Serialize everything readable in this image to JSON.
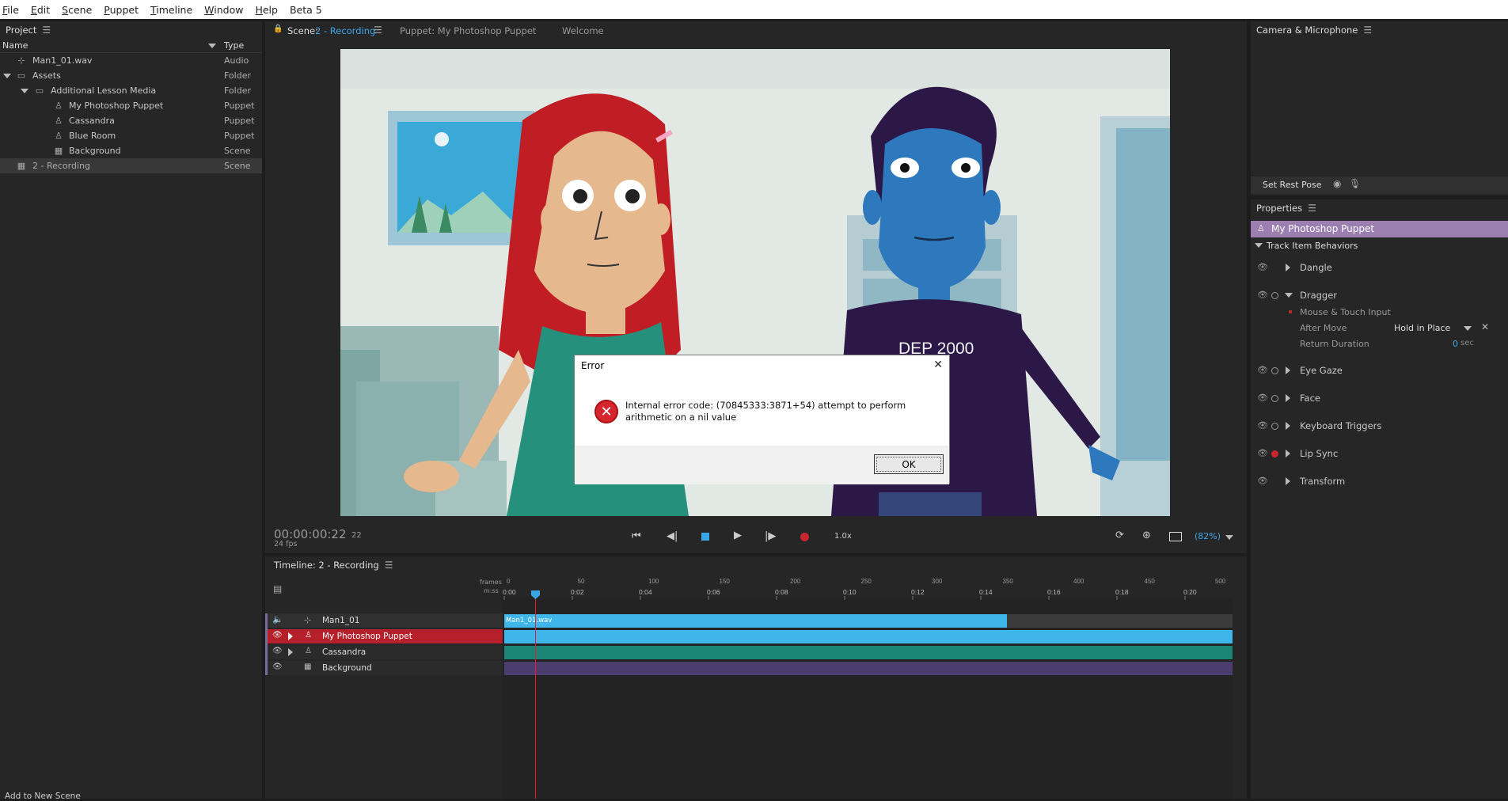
{
  "menu": [
    "File",
    "Edit",
    "Scene",
    "Puppet",
    "Timeline",
    "Window",
    "Help",
    "Beta 5"
  ],
  "project": {
    "title": "Project",
    "col_name": "Name",
    "col_type": "Type",
    "items": [
      {
        "name": "Man1_01.wav",
        "type": "Audio"
      },
      {
        "name": "Assets",
        "type": "Folder"
      },
      {
        "name": "Additional Lesson Media",
        "type": "Folder"
      },
      {
        "name": "My Photoshop Puppet",
        "type": "Puppet"
      },
      {
        "name": "Cassandra",
        "type": "Puppet"
      },
      {
        "name": "Blue Room",
        "type": "Puppet"
      },
      {
        "name": "Background",
        "type": "Scene"
      },
      {
        "name": "2 - Recording",
        "type": "Scene"
      }
    ],
    "add_scene": "Add to New Scene"
  },
  "tabs": {
    "scene_prefix": "Scene:",
    "scene_name": "2 - Recording",
    "puppet": "Puppet: My Photoshop Puppet",
    "welcome": "Welcome"
  },
  "scene_art": {
    "shirt_text": "DEP 2000"
  },
  "transport": {
    "timecode": "00:00:00:22",
    "frame": "22",
    "fps": "24 fps",
    "speed": "1.0x",
    "zoom": "(82%)"
  },
  "camera": {
    "title": "Camera & Microphone",
    "rest_pose": "Set Rest Pose"
  },
  "properties": {
    "title": "Properties",
    "puppet": "My Photoshop Puppet",
    "section": "Track Item Behaviors",
    "behaviors": [
      "Dangle",
      "Dragger",
      "Eye Gaze",
      "Face",
      "Keyboard Triggers",
      "Lip Sync",
      "Transform"
    ],
    "dragger": {
      "mouse": "Mouse & Touch Input",
      "after_move_label": "After Move",
      "after_move_value": "Hold in Place",
      "return_label": "Return Duration",
      "return_value": "0",
      "return_unit": "sec"
    }
  },
  "timeline": {
    "title": "Timeline: 2 - Recording",
    "frames_label": "frames",
    "mss_label": "m:ss",
    "frame_ticks": [
      "0",
      "50",
      "100",
      "150",
      "200",
      "250",
      "300",
      "350",
      "400",
      "450",
      "500"
    ],
    "time_ticks": [
      "0:00",
      "0:02",
      "0:04",
      "0:06",
      "0:08",
      "0:10",
      "0:12",
      "0:14",
      "0:16",
      "0:18",
      "0:20"
    ],
    "tracks": [
      "Man1_01",
      "My Photoshop Puppet",
      "Cassandra",
      "Background"
    ],
    "audio_clip": "Man1_01.wav",
    "colors": {
      "audio": "#3fb6ea",
      "puppet": "#3fb6ea",
      "cassandra": "#1a8575",
      "background": "#4b3d6e",
      "selected_track": "#b5202a",
      "playhead": "#e0232b"
    }
  },
  "dialog": {
    "title": "Error",
    "message": "Internal error code: (70845333:3871+54) attempt to perform arithmetic on a nil value",
    "ok": "OK"
  }
}
